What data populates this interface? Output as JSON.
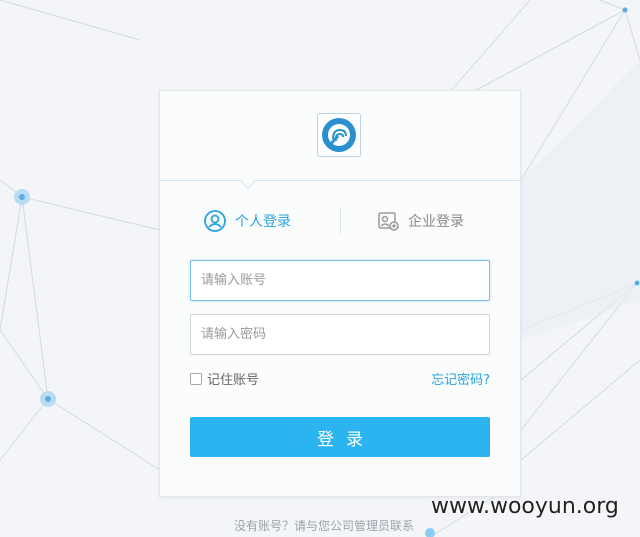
{
  "tabs": [
    {
      "label": "个人登录",
      "icon": "person-icon",
      "active": true
    },
    {
      "label": "企业登录",
      "icon": "enterprise-card-icon",
      "active": false
    }
  ],
  "form": {
    "account_placeholder": "请输入账号",
    "password_placeholder": "请输入密码",
    "remember_label": "记住账号",
    "forgot_label": "忘记密码?",
    "submit_label": "登录"
  },
  "footer": {
    "text": "没有账号？请与您公司管理员联系"
  },
  "watermark": "www.wooyun.org",
  "logo": {
    "text": "FINGERPRINT"
  },
  "colors": {
    "accent": "#2bb4ef",
    "link": "#2aa3e0",
    "background": "#f3f5f8"
  }
}
